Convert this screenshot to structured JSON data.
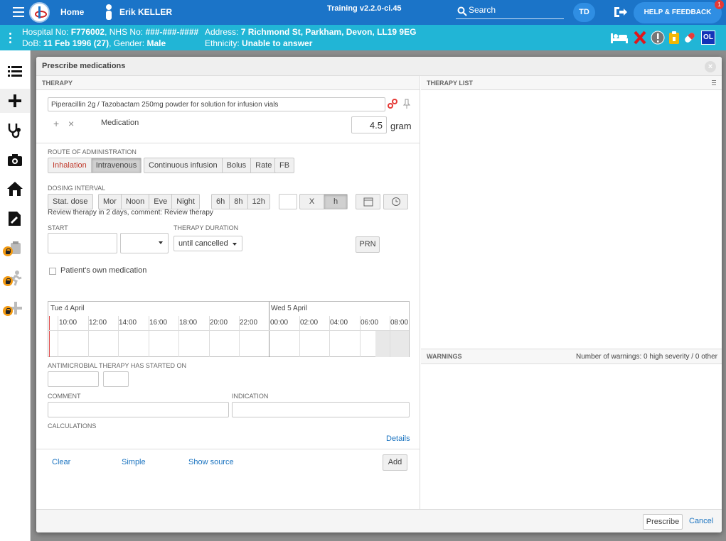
{
  "topbar": {
    "home": "Home",
    "user": "Erik KELLER",
    "training": "Training v2.2.0-ci.45",
    "search": "Search",
    "initials": "TD",
    "help": "HELP & FEEDBACK",
    "badge": "1"
  },
  "patient": {
    "hospital_label": "Hospital No: ",
    "hospital_no": "F776002",
    "nhs_label": ", NHS No: ",
    "nhs_no": "###-###-####",
    "dob_label": "DoB: ",
    "dob": "11 Feb 1996 (27)",
    "gender_label": ", Gender: ",
    "gender": "Male",
    "address_label": "Address: ",
    "address": "7 Richmond St, Parkham, Devon, LL19 9EG",
    "ethnicity_label": "Ethnicity: ",
    "ethnicity": "Unable to answer",
    "alert_ol": "OL"
  },
  "modal": {
    "title": "Prescribe medications",
    "therapy_header": "THERAPY",
    "therapy_list_header": "THERAPY LIST",
    "warnings_header": "WARNINGS",
    "warnings_summary": "Number of warnings: 0 high severity / 0 other",
    "medication_value": "Piperacillin 2g / Tazobactam 250mg powder for solution for infusion vials",
    "add_symbol": "+",
    "remove_symbol": "×",
    "medication_label": "Medication",
    "dose_value": "4.5",
    "dose_unit": "gram",
    "route_label": "ROUTE OF ADMINISTRATION",
    "route_inhalation": "Inhalation",
    "route_intravenous": "Intravenous",
    "mode_continuous": "Continuous infusion",
    "mode_bolus": "Bolus",
    "mode_rate": "Rate",
    "mode_fb": "FB",
    "dosing_label": "DOSING INTERVAL",
    "stat_dose": "Stat. dose",
    "mor": "Mor",
    "noon": "Noon",
    "eve": "Eve",
    "night": "Night",
    "h6": "6h",
    "h8": "8h",
    "h12": "12h",
    "x": "X",
    "h": "h",
    "review_text": "Review therapy in 2 days, comment: Review therapy",
    "start_label": "START",
    "duration_label": "THERAPY DURATION",
    "duration_value": "until cancelled",
    "prn": "PRN",
    "own_medication": "Patient's own medication",
    "day1": "Tue 4 April",
    "day2": "Wed 5 April",
    "hours": [
      "10:00",
      "12:00",
      "14:00",
      "16:00",
      "18:00",
      "20:00",
      "22:00",
      "00:00",
      "02:00",
      "04:00",
      "06:00",
      "08:00"
    ],
    "antimicrobial_label": "ANTIMICROBIAL THERAPY HAS STARTED ON",
    "comment_label": "COMMENT",
    "indication_label": "INDICATION",
    "calculations_label": "CALCULATIONS",
    "details": "Details",
    "clear": "Clear",
    "simple": "Simple",
    "show_source": "Show source",
    "add": "Add",
    "prescribe": "Prescribe",
    "cancel": "Cancel"
  }
}
